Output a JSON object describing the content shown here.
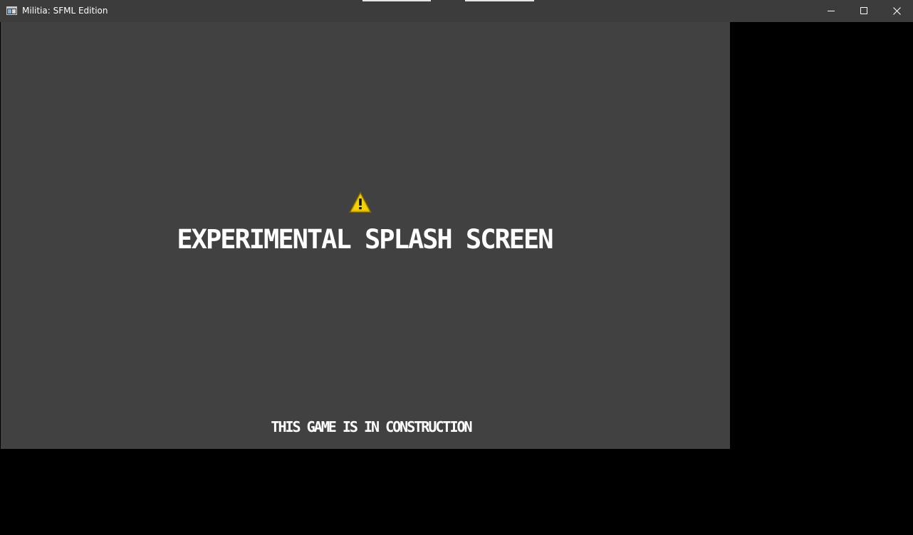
{
  "window": {
    "title": "Militia: SFML Edition",
    "icon": "app-window-icon",
    "controls": {
      "minimize": "minimize-icon",
      "maximize": "maximize-icon",
      "close": "close-icon"
    }
  },
  "splash": {
    "icon": "warning-icon",
    "icon_color": "#e8c000",
    "headline": "EXPERIMENTAL SPLASH SCREEN",
    "footer": "THIS GAME IS IN CONSTRUCTION"
  },
  "colors": {
    "titlebar": "#3c3c3c",
    "viewport": "#414141",
    "outside": "#000000",
    "text": "#ffffff"
  }
}
